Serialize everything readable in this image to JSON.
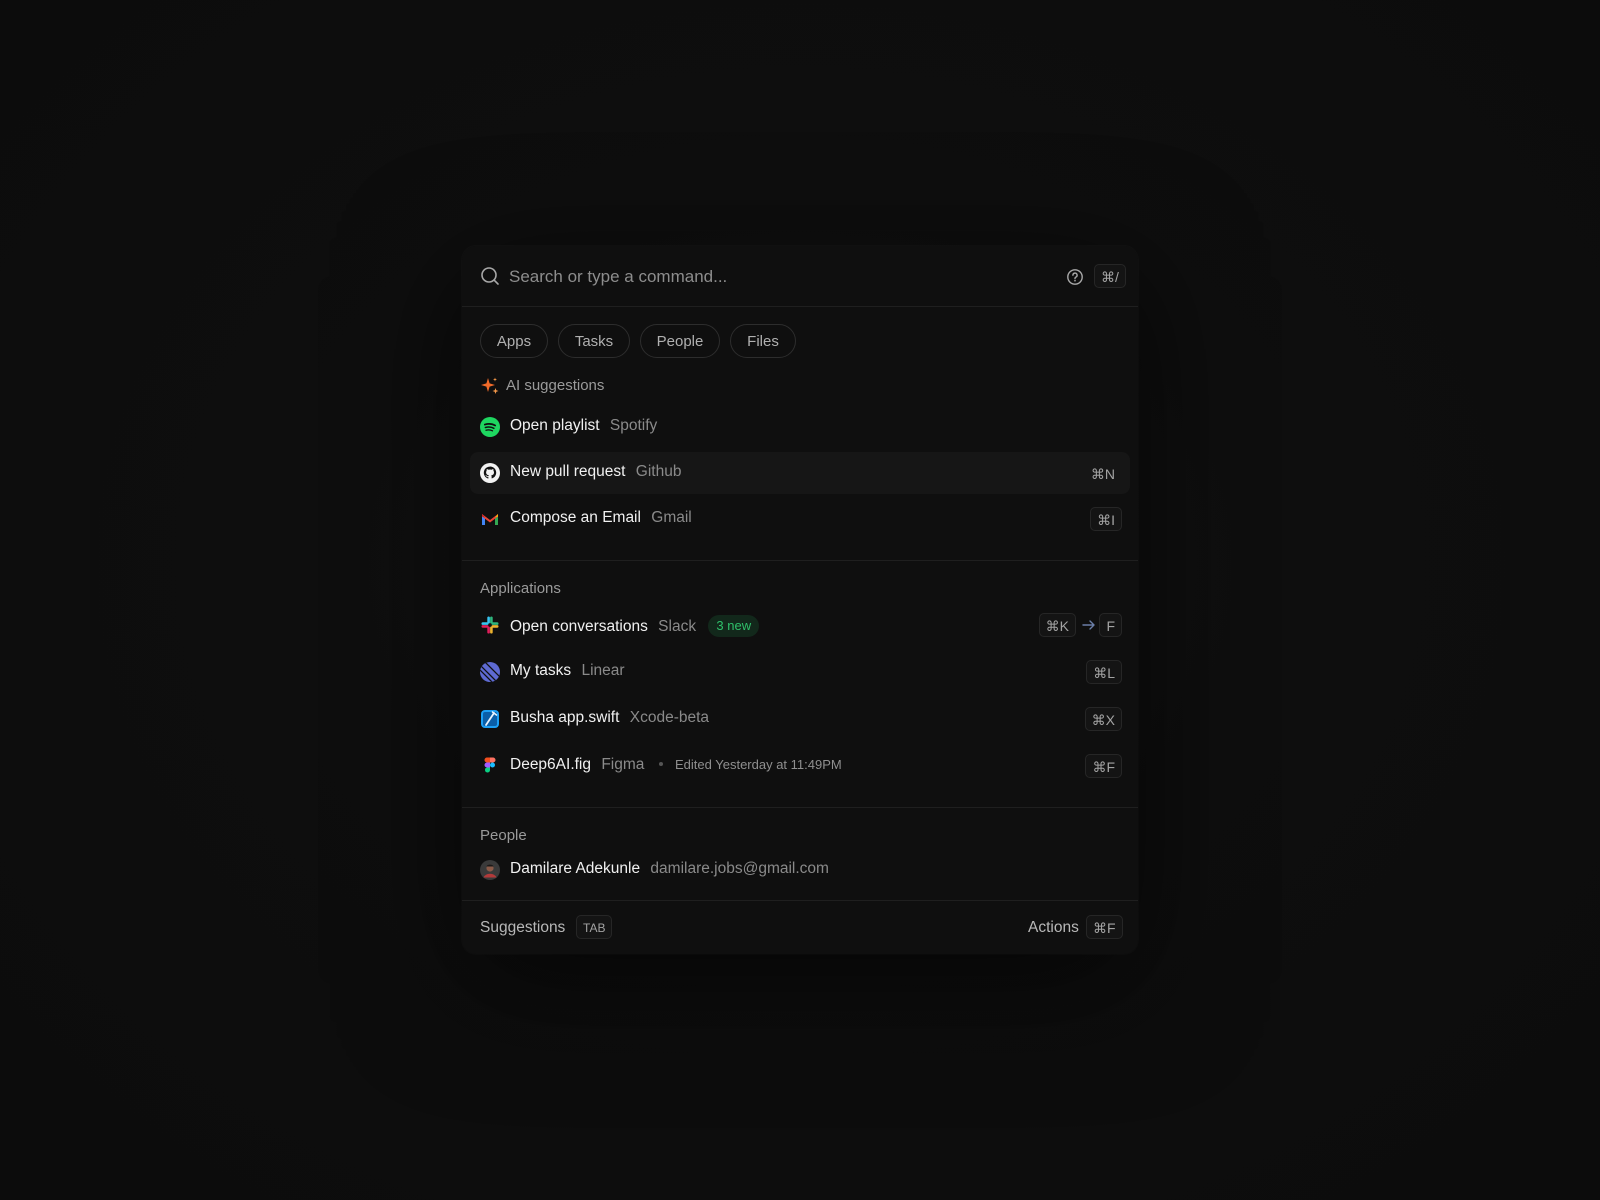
{
  "search": {
    "placeholder": "Search or type a command...",
    "shortcut": "⌘/"
  },
  "filters": [
    "Apps",
    "Tasks",
    "People",
    "Files"
  ],
  "ai_suggestions": {
    "title": "AI suggestions",
    "items": [
      {
        "title": "Open playlist",
        "app": "Spotify",
        "shortcut": "",
        "icon": "spotify-icon"
      },
      {
        "title": "New pull request",
        "app": "Github",
        "shortcut": "⌘N",
        "icon": "github-icon",
        "active": true
      },
      {
        "title": "Compose an Email",
        "app": "Gmail",
        "shortcut": "⌘I",
        "icon": "gmail-icon"
      }
    ]
  },
  "applications": {
    "title": "Applications",
    "items": [
      {
        "title": "Open conversations",
        "app": "Slack",
        "badge": "3 new",
        "shortcut": "⌘K",
        "shortcut_then": "F",
        "icon": "slack-icon"
      },
      {
        "title": "My tasks",
        "app": "Linear",
        "shortcut": "⌘L",
        "icon": "linear-icon"
      },
      {
        "title": "Busha app.swift",
        "app": "Xcode-beta",
        "shortcut": "⌘X",
        "icon": "xcode-icon"
      },
      {
        "title": "Deep6AI.fig",
        "app": "Figma",
        "meta": "Edited Yesterday at 11:49PM",
        "shortcut": "⌘F",
        "icon": "figma-icon"
      }
    ]
  },
  "people": {
    "title": "People",
    "items": [
      {
        "name": "Damilare Adekunle",
        "email": "damilare.jobs@gmail.com",
        "icon": "avatar"
      }
    ]
  },
  "footer": {
    "left_label": "Suggestions",
    "left_key": "TAB",
    "right_label": "Actions",
    "right_key": "⌘F"
  },
  "colors": {
    "background": "#0c0c0c",
    "panel": "#0f0f0f",
    "badge_green": "#2fbf6a",
    "spark_orange": "#f26b2a"
  }
}
